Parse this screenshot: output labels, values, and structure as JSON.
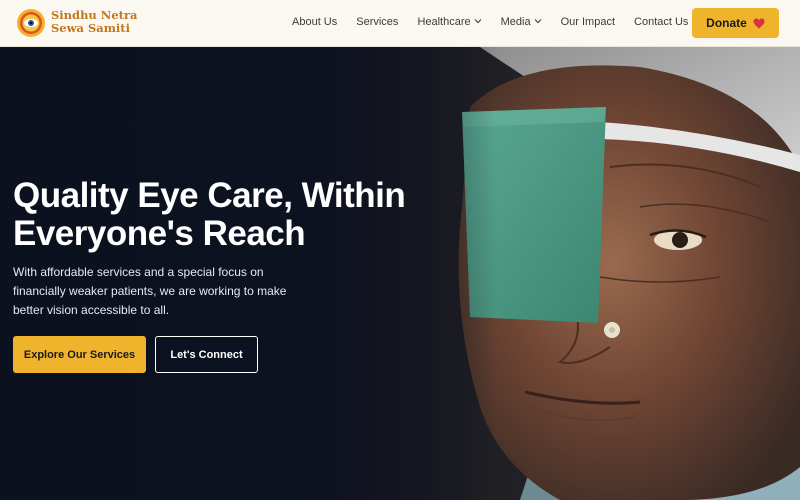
{
  "brand": {
    "line1": "Sindhu Netra",
    "line2": "Sewa Samiti"
  },
  "nav": [
    {
      "label": "About Us",
      "dropdown": false
    },
    {
      "label": "Services",
      "dropdown": false
    },
    {
      "label": "Healthcare",
      "dropdown": true
    },
    {
      "label": "Media",
      "dropdown": true
    },
    {
      "label": "Our Impact",
      "dropdown": false
    },
    {
      "label": "Contact Us",
      "dropdown": false
    }
  ],
  "donate": {
    "label": "Donate",
    "icon": "heart-icon"
  },
  "hero": {
    "title_line1": "Quality Eye Care, Within",
    "title_line2": "Everyone's Reach",
    "description": "With affordable services and a special focus on financially weaker patients, we are working to make better vision accessible to all.",
    "primary_button": "Explore Our Services",
    "secondary_button": "Let's Connect"
  },
  "colors": {
    "accent": "#efb42c",
    "brand_text": "#c4761a",
    "header_bg": "#fbf8f2",
    "hero_dark": "#0f1524",
    "heart": "#d9333f",
    "eye_patch": "#4e9a84"
  }
}
